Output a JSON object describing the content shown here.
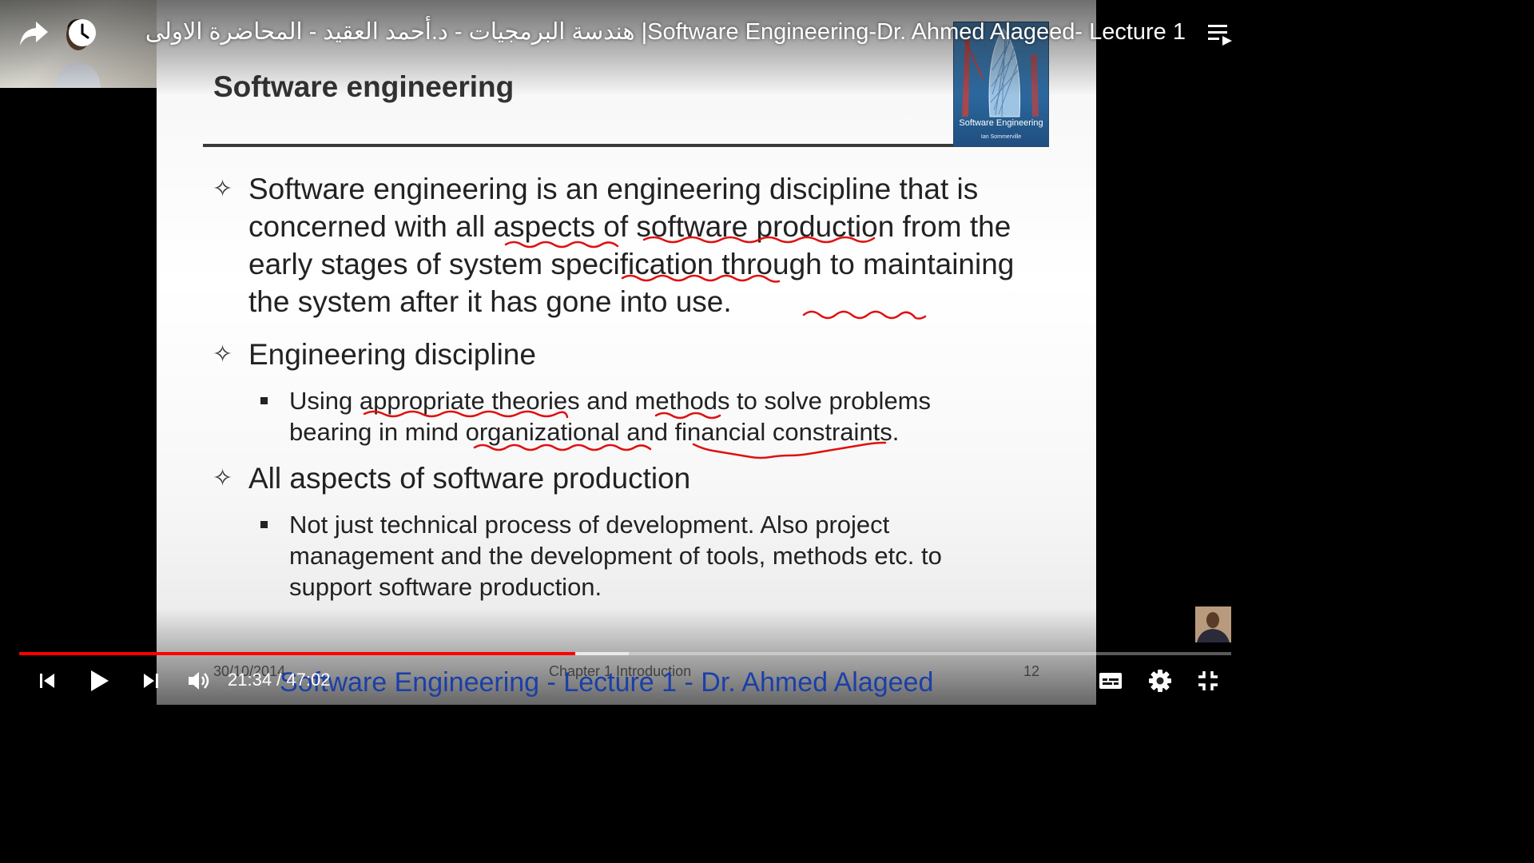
{
  "video": {
    "title": "هندسة البرمجيات - د.أحمد العقيد - المحاضرة الاولى |Software Engineering-Dr. Ahmed Alageed- Lecture 1",
    "current_time": "21:34",
    "duration": "47:02",
    "time_display": "21:34 / 47:02",
    "progress_fraction": 0.459,
    "buffered_fraction": 0.503
  },
  "slide": {
    "title": "Software engineering",
    "book": {
      "title": "Software Engineering",
      "author": "Ian Sommerville"
    },
    "bullets": [
      {
        "text": "Software engineering is an engineering discipline that is concerned with all aspects of software production from the early stages of system specification through to maintaining the system after it has gone into use."
      },
      {
        "text": "Engineering discipline",
        "sub": "Using appropriate theories and methods to solve problems bearing in mind organizational and financial constraints."
      },
      {
        "text": "All aspects of software production",
        "sub": "Not just technical process of development. Also project management and the development of tools, methods etc. to support software production."
      }
    ],
    "footer": {
      "date": "30/10/2014",
      "chapter": "Chapter 1 Introduction",
      "page": "12"
    },
    "watermark": "Software Engineering  - Lecture 1 - Dr. Ahmed Alageed"
  },
  "icons": {
    "share": "share-icon",
    "watch_later": "clock-icon",
    "playlist": "playlist-icon",
    "previous": "skip-previous-icon",
    "play": "play-icon",
    "next": "skip-next-icon",
    "volume": "volume-icon",
    "captions": "captions-icon",
    "settings": "gear-icon",
    "exit_fullscreen": "exit-fullscreen-icon"
  },
  "colors": {
    "progress": "#ff0000",
    "annotation": "#e01010",
    "watermark": "#1b3fa8"
  }
}
